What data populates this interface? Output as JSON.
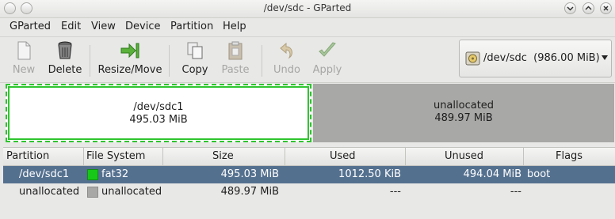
{
  "window": {
    "title": "/dev/sdc - GParted"
  },
  "menubar": {
    "items": [
      "GParted",
      "Edit",
      "View",
      "Device",
      "Partition",
      "Help"
    ]
  },
  "toolbar": {
    "new": "New",
    "delete": "Delete",
    "resize_move": "Resize/Move",
    "copy": "Copy",
    "paste": "Paste",
    "undo": "Undo",
    "apply": "Apply"
  },
  "device_selector": {
    "device": "/dev/sdc",
    "size": "(986.00 MiB)"
  },
  "partition_map": [
    {
      "name": "/dev/sdc1",
      "size": "495.03 MiB",
      "border_color": "#2fc52f"
    },
    {
      "name": "unallocated",
      "size": "489.97 MiB",
      "fill_color": "#a8a8a6"
    }
  ],
  "table": {
    "headers": [
      "Partition",
      "File System",
      "Size",
      "Used",
      "Unused",
      "Flags"
    ],
    "rows": [
      {
        "partition": "/dev/sdc1",
        "fs": "fat32",
        "fs_color": "#18c818",
        "size": "495.03 MiB",
        "used": "1012.50 KiB",
        "unused": "494.04 MiB",
        "flags": "boot"
      },
      {
        "partition": "unallocated",
        "fs": "unallocated",
        "fs_color": "#a8a8a6",
        "size": "489.97 MiB",
        "used": "---",
        "unused": "---",
        "flags": ""
      }
    ]
  }
}
